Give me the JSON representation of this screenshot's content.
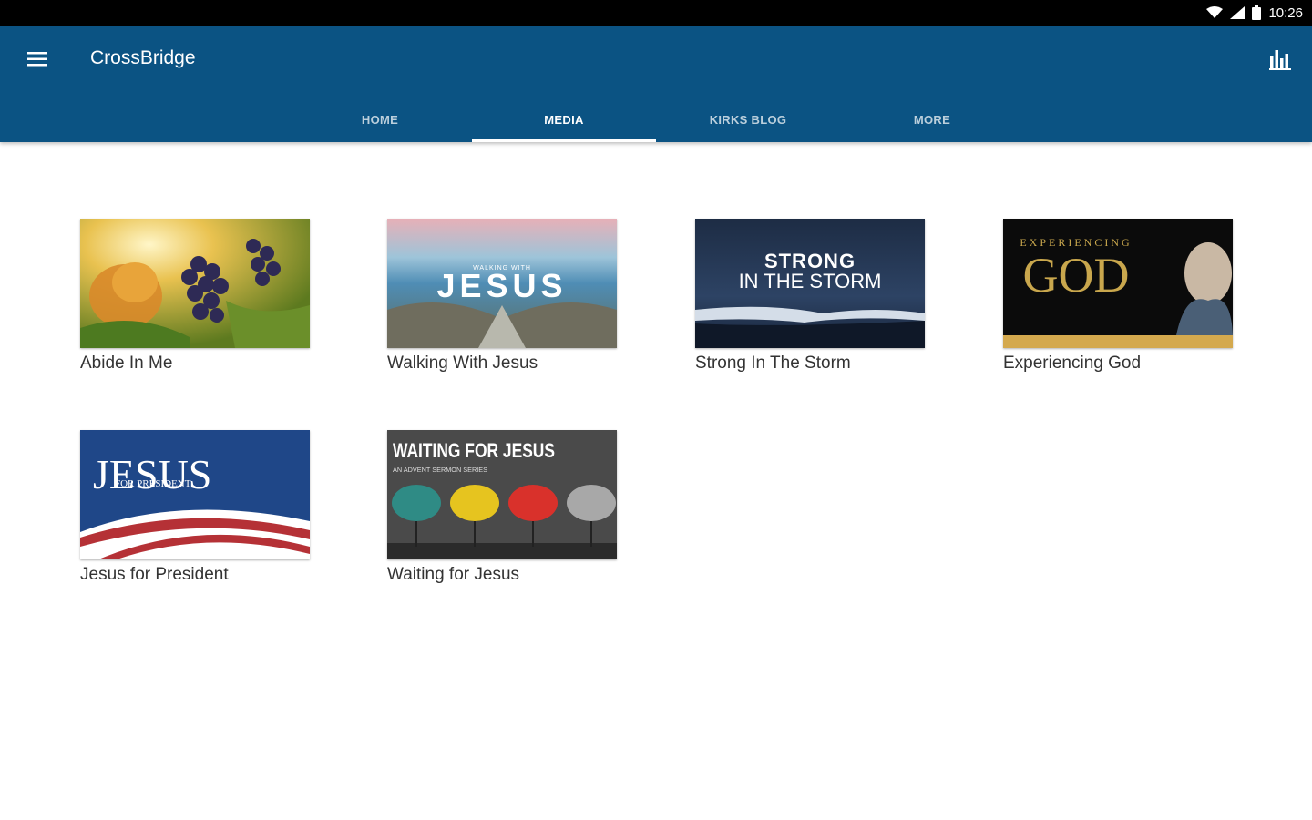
{
  "status_bar": {
    "time": "10:26",
    "icons": [
      "wifi-icon",
      "signal-icon",
      "battery-icon"
    ]
  },
  "app_bar": {
    "title": "CrossBridge",
    "menu_icon": "hamburger-menu-icon",
    "action_icon": "bar-chart-icon",
    "color": "#0b5383"
  },
  "tabs": [
    {
      "label": "HOME",
      "active": false
    },
    {
      "label": "MEDIA",
      "active": true
    },
    {
      "label": "KIRKS BLOG",
      "active": false
    },
    {
      "label": "MORE",
      "active": false
    }
  ],
  "media_items": [
    {
      "title": "Abide In Me",
      "thumb_text": "",
      "thumb_subtext": ""
    },
    {
      "title": "Walking With Jesus",
      "thumb_text": "JESUS",
      "thumb_subtext": "WALKING WITH"
    },
    {
      "title": "Strong In The Storm",
      "thumb_text": "STRONG",
      "thumb_subtext": "IN THE STORM"
    },
    {
      "title": "Experiencing God",
      "thumb_text": "GOD",
      "thumb_subtext": "EXPERIENCING"
    },
    {
      "title": "Jesus for President",
      "thumb_text": "JESUS",
      "thumb_subtext": "FOR PRESIDENT"
    },
    {
      "title": "Waiting for Jesus",
      "thumb_text": "WAITING FOR JESUS",
      "thumb_subtext": "AN ADVENT SERMON SERIES"
    }
  ]
}
